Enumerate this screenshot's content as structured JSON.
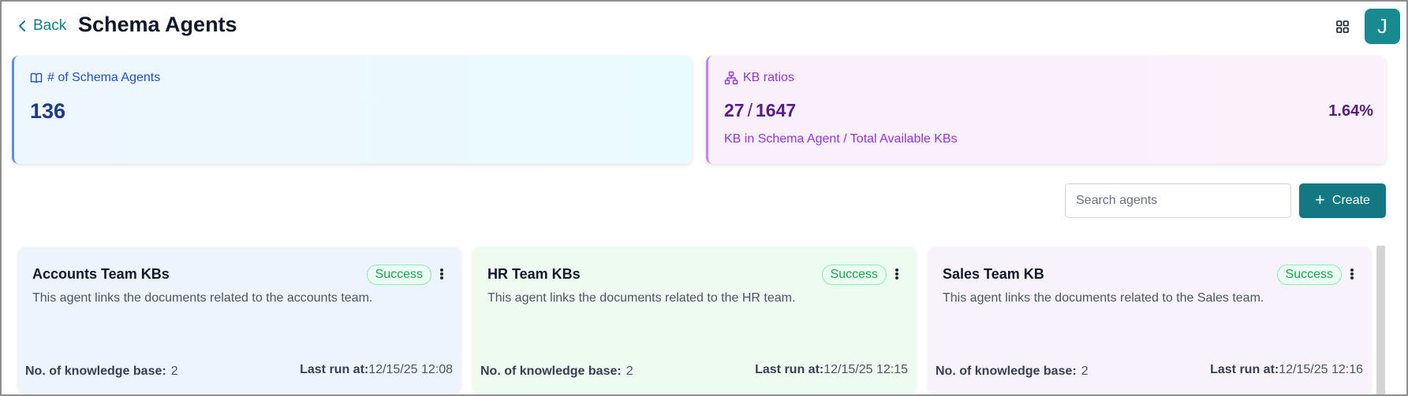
{
  "header": {
    "back_label": "Back",
    "title": "Schema Agents",
    "avatar_initial": "J"
  },
  "stats": {
    "agents": {
      "label": "# of Schema Agents",
      "value": "136"
    },
    "kb": {
      "label": "KB ratios",
      "numerator": "27",
      "separator": "/",
      "denominator": "1647",
      "percent": "1.64%",
      "caption": "KB in Schema Agent / Total Available KBs"
    }
  },
  "toolbar": {
    "search_placeholder": "Search agents",
    "create_label": "Create"
  },
  "agents": [
    {
      "title": "Accounts Team KBs",
      "status": "Success",
      "description": "This agent links the documents related to the accounts team.",
      "kb_label": "No. of knowledge base:",
      "kb_count": "2",
      "last_run_label": "Last run at:",
      "last_run": "12/15/25 12:08"
    },
    {
      "title": "HR Team KBs",
      "status": "Success",
      "description": "This agent links the documents related to the HR team.",
      "kb_label": "No. of knowledge base:",
      "kb_count": "2",
      "last_run_label": "Last run at:",
      "last_run": "12/15/25 12:15"
    },
    {
      "title": "Sales Team KB",
      "status": "Success",
      "description": "This agent links the documents related to the Sales team.",
      "kb_label": "No. of knowledge base:",
      "kb_count": "2",
      "last_run_label": "Last run at:",
      "last_run": "12/15/25 12:16"
    }
  ],
  "colors": {
    "accent": "#137882",
    "agents_stat": "#1e3a8a",
    "kb_stat": "#9333ea",
    "success": "#16a34a",
    "card_bg": [
      "#eef4fd",
      "#edfbf1",
      "#f8f2fd"
    ]
  },
  "icons": {
    "back": "chevron-left-icon",
    "grid": "grid-icon",
    "agents": "book-open-icon",
    "kb": "hierarchy-icon",
    "create": "plus-icon",
    "menu": "more-vertical-icon"
  }
}
